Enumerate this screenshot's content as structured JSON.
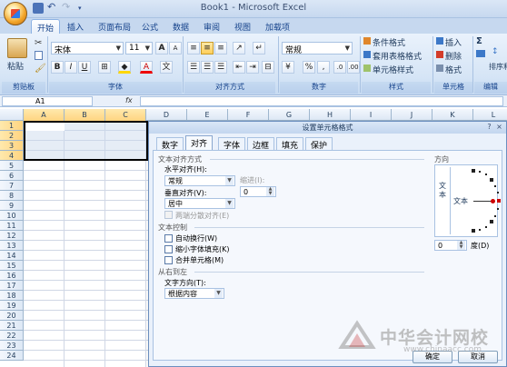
{
  "window": {
    "title": "Book1 - Microsoft Excel"
  },
  "tabs": [
    "开始",
    "插入",
    "页面布局",
    "公式",
    "数据",
    "审阅",
    "视图",
    "加载项"
  ],
  "ribbon": {
    "paste": "粘贴",
    "font_name": "宋体",
    "font_size": "11",
    "grow_font": "A",
    "shrink_font": "A",
    "bold": "B",
    "italic": "I",
    "underline": "U",
    "font_color_letter": "A",
    "number_format": "常规",
    "currency": "¥",
    "percent": "%",
    "comma": ",",
    "cond_format": "条件格式",
    "table_format": "套用表格格式",
    "cell_style": "单元格样式",
    "insert": "插入",
    "delete": "删除",
    "format": "格式",
    "sum": "Σ",
    "sort_filter": "排序和筛选",
    "groups": [
      "剪贴板",
      "字体",
      "对齐方式",
      "数字",
      "样式",
      "单元格",
      "编辑"
    ]
  },
  "formula_bar": {
    "name_box": "A1",
    "fx": "fx",
    "value": ""
  },
  "columns": [
    "A",
    "B",
    "C",
    "D",
    "E",
    "F",
    "G",
    "H",
    "I",
    "J",
    "K",
    "L"
  ],
  "rows": [
    "1",
    "2",
    "3",
    "4",
    "5",
    "6",
    "7",
    "8",
    "9",
    "10",
    "11",
    "12",
    "13",
    "14",
    "15",
    "16",
    "17",
    "18",
    "19",
    "20",
    "21",
    "22",
    "23",
    "24"
  ],
  "dialog": {
    "title": "设置单元格格式",
    "help": "?",
    "close": "×",
    "tabs": [
      "数字",
      "对齐",
      "字体",
      "边框",
      "填充",
      "保护"
    ],
    "active_tab": "对齐",
    "text_alignment": {
      "section": "文本对齐方式",
      "horizontal_label": "水平对齐(H):",
      "horizontal_value": "常规",
      "indent_label": "缩进(I):",
      "indent_value": "0",
      "vertical_label": "垂直对齐(V):",
      "vertical_value": "居中",
      "justify_distributed": "两端分散对齐(E)"
    },
    "text_control": {
      "section": "文本控制",
      "wrap": "自动换行(W)",
      "shrink": "缩小字体填充(K)",
      "merge": "合并单元格(M)"
    },
    "rtl": {
      "section": "从右到左",
      "direction_label": "文字方向(T):",
      "direction_value": "根据内容"
    },
    "orientation": {
      "section": "方向",
      "vertical_text": "文本",
      "horizontal_text": "文本",
      "degrees_value": "0",
      "degrees_label": "度(D)"
    },
    "ok": "确定",
    "cancel": "取消"
  },
  "watermark": {
    "text": "中华会计网校",
    "url": "www.chinaacc.com"
  }
}
